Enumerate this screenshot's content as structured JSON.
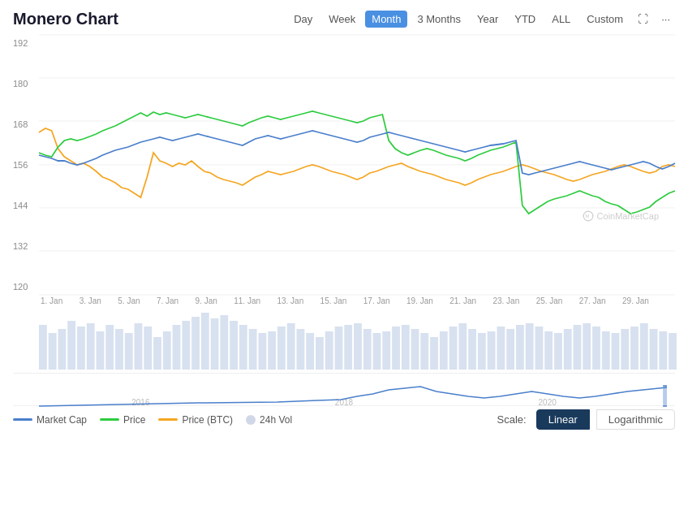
{
  "title": "Monero Chart",
  "timeButtons": [
    {
      "label": "Day",
      "active": false
    },
    {
      "label": "Week",
      "active": false
    },
    {
      "label": "Month",
      "active": true
    },
    {
      "label": "3 Months",
      "active": false
    },
    {
      "label": "Year",
      "active": false
    },
    {
      "label": "YTD",
      "active": false
    },
    {
      "label": "ALL",
      "active": false
    },
    {
      "label": "Custom",
      "active": false
    }
  ],
  "yLabels": [
    "192",
    "180",
    "168",
    "156",
    "144",
    "132",
    "120"
  ],
  "xLabels": [
    "1. Jan",
    "3. Jan",
    "5. Jan",
    "7. Jan",
    "9. Jan",
    "11. Jan",
    "13. Jan",
    "15. Jan",
    "17. Jan",
    "19. Jan",
    "21. Jan",
    "23. Jan",
    "25. Jan",
    "27. Jan",
    "29. Jan"
  ],
  "bottomLabels": [
    "2016",
    "2018",
    "2020"
  ],
  "legend": [
    {
      "label": "Market Cap",
      "color": "#4a7fcb",
      "type": "line"
    },
    {
      "label": "Price",
      "color": "#2ecc40",
      "type": "line"
    },
    {
      "label": "Price (BTC)",
      "color": "#f5a623",
      "type": "line"
    },
    {
      "label": "24h Vol",
      "color": "#d0d8e8",
      "type": "circle"
    }
  ],
  "scale": {
    "label": "Scale:",
    "options": [
      {
        "label": "Linear",
        "active": true
      },
      {
        "label": "Logarithmic",
        "active": false
      }
    ]
  },
  "watermark": "CoinMarketCap"
}
